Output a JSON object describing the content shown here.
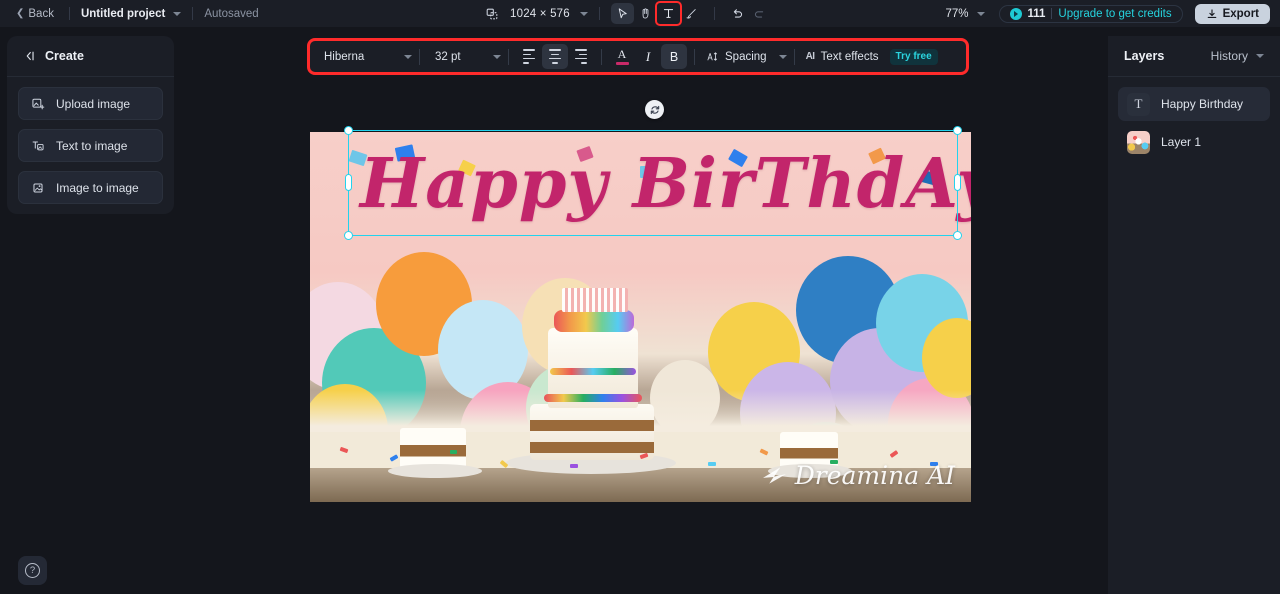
{
  "topbar": {
    "back_label": "Back",
    "project_title": "Untitled project",
    "autosaved_label": "Autosaved",
    "canvas_size": "1024 × 576",
    "zoom_level": "77%",
    "credits_count": "111",
    "upgrade_label": "Upgrade to get credits",
    "export_label": "Export",
    "tools": [
      {
        "name": "frame-icon",
        "label": "Frame"
      },
      {
        "name": "select-icon",
        "label": "Select",
        "active": true
      },
      {
        "name": "hand-icon",
        "label": "Hand"
      },
      {
        "name": "text-tool-icon",
        "label": "T",
        "highlighted": true
      },
      {
        "name": "brush-icon",
        "label": "Brush"
      },
      {
        "name": "undo-icon",
        "label": "Undo"
      },
      {
        "name": "redo-icon",
        "label": "Redo"
      }
    ]
  },
  "left_panel": {
    "title": "Create",
    "items": [
      {
        "label": "Upload image",
        "icon": "upload-image-icon"
      },
      {
        "label": "Text to image",
        "icon": "text-to-image-icon"
      },
      {
        "label": "Image to image",
        "icon": "image-to-image-icon"
      }
    ]
  },
  "text_toolbar": {
    "font_family": "Hiberna",
    "font_size": "32 pt",
    "align_left": "Align left",
    "align_center": "Align center",
    "align_right": "Align right",
    "text_color_label": "A",
    "text_color_value": "#c92a69",
    "italic_label": "I",
    "bold_label": "B",
    "spacing_label": "Spacing",
    "ai_label": "AI",
    "text_effects_label": "Text effects",
    "try_free_label": "Try free",
    "highlight_color": "#ff2b2b"
  },
  "canvas": {
    "headline_text": "Happy BirThdAy",
    "headline_color": "#c2256b",
    "watermark": "Dreamina AI",
    "selection_color": "#22d3ee"
  },
  "right_panel": {
    "title": "Layers",
    "history_label": "History",
    "layers": [
      {
        "label": "Happy Birthday",
        "type": "text",
        "selected": true
      },
      {
        "label": "Layer 1",
        "type": "image",
        "selected": false
      }
    ]
  },
  "help": {
    "label": "?"
  }
}
